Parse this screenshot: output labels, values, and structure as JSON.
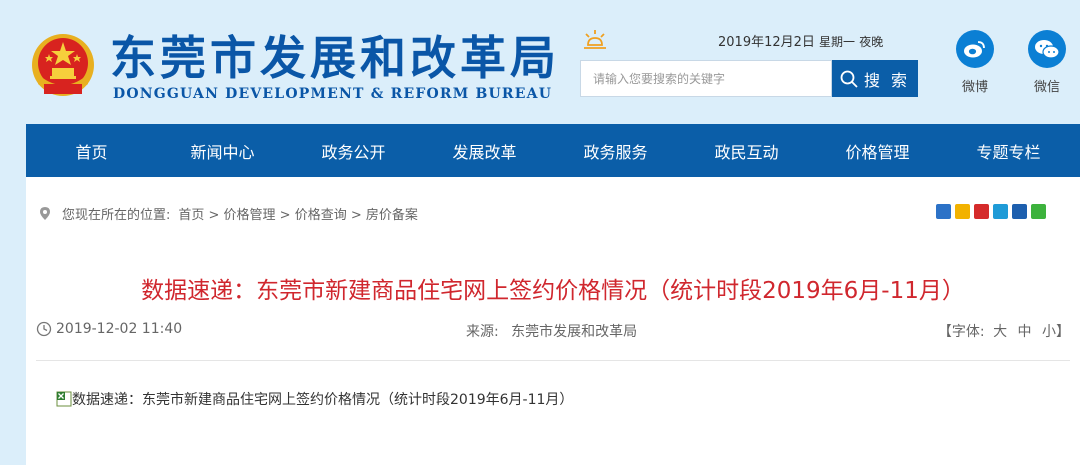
{
  "header": {
    "site_title": "东莞市发展和改革局",
    "site_subtitle": "DONGGUAN DEVELOPMENT & REFORM BUREAU",
    "date": "2019年12月2日",
    "weekday": "星期一",
    "time_of_day": "夜晚",
    "search": {
      "placeholder": "请输入您要搜索的关键字",
      "button_label": "搜 索"
    },
    "social": [
      {
        "label": "微博",
        "icon": "weibo-icon",
        "color": "#0b7fd4"
      },
      {
        "label": "微信",
        "icon": "wechat-icon",
        "color": "#0b7fd4"
      }
    ]
  },
  "nav": {
    "items": [
      "首页",
      "新闻中心",
      "政务公开",
      "发展改革",
      "政务服务",
      "政民互动",
      "价格管理",
      "专题专栏"
    ]
  },
  "breadcrumb": {
    "prefix": "您现在所在的位置:",
    "path": "首页 > 价格管理 > 价格查询 > 房价备案"
  },
  "share_icons": [
    {
      "icon": "plus-share-icon",
      "color": "#2c72c7"
    },
    {
      "icon": "qzone-icon",
      "color": "#f2b200"
    },
    {
      "icon": "sina-weibo-icon",
      "color": "#d52b2b"
    },
    {
      "icon": "tencent-weibo-icon",
      "color": "#1f9bd7"
    },
    {
      "icon": "renren-icon",
      "color": "#1d5fae"
    },
    {
      "icon": "wechat-share-icon",
      "color": "#3db23d"
    }
  ],
  "article": {
    "title": "数据速递：东莞市新建商品住宅网上签约价格情况（统计时段2019年6月-11月）",
    "datetime": "2019-12-02 11:40",
    "source_label": "来源:",
    "source": "东莞市发展和改革局",
    "font_label": "【字体:",
    "font_large": "大",
    "font_medium": "中",
    "font_small": "小",
    "font_close": "】",
    "attachment": "数据速递：东莞市新建商品住宅网上签约价格情况（统计时段2019年6月-11月）"
  },
  "colors": {
    "brand_blue": "#0b5ea8",
    "title_red": "#d0272e",
    "page_bg": "#dbeefa"
  }
}
